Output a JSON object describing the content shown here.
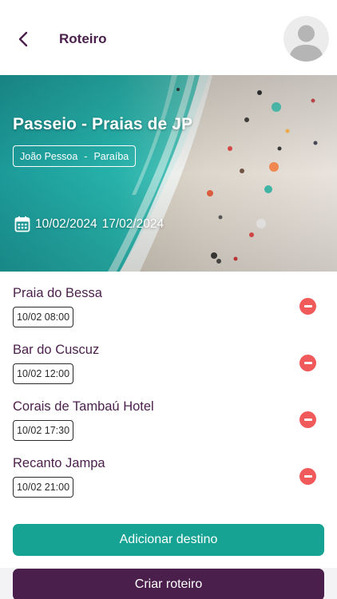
{
  "header": {
    "title": "Roteiro",
    "back_icon": "chevron-left-icon",
    "avatar_icon": "user-avatar-icon"
  },
  "trip": {
    "title": "Passeio - Praias de JP",
    "city": "João Pessoa",
    "separator": "-",
    "state": "Paraíba",
    "start_date": "10/02/2024",
    "end_date": "17/02/2024",
    "calendar_icon": "calendar-icon"
  },
  "destinations": [
    {
      "name": "Praia do Bessa",
      "time": "10/02 08:00"
    },
    {
      "name": "Bar do Cuscuz",
      "time": "10/02 12:00"
    },
    {
      "name": "Corais de Tambaú Hotel",
      "time": "10/02 17:30"
    },
    {
      "name": "Recanto Jampa",
      "time": "10/02 21:00"
    }
  ],
  "actions": {
    "add_label": "Adicionar destino",
    "create_label": "Criar roteiro",
    "remove_icon": "minus-circle-icon"
  },
  "colors": {
    "brand": "#4a1f4b",
    "teal": "#16a393",
    "danger": "#f05a5a"
  }
}
